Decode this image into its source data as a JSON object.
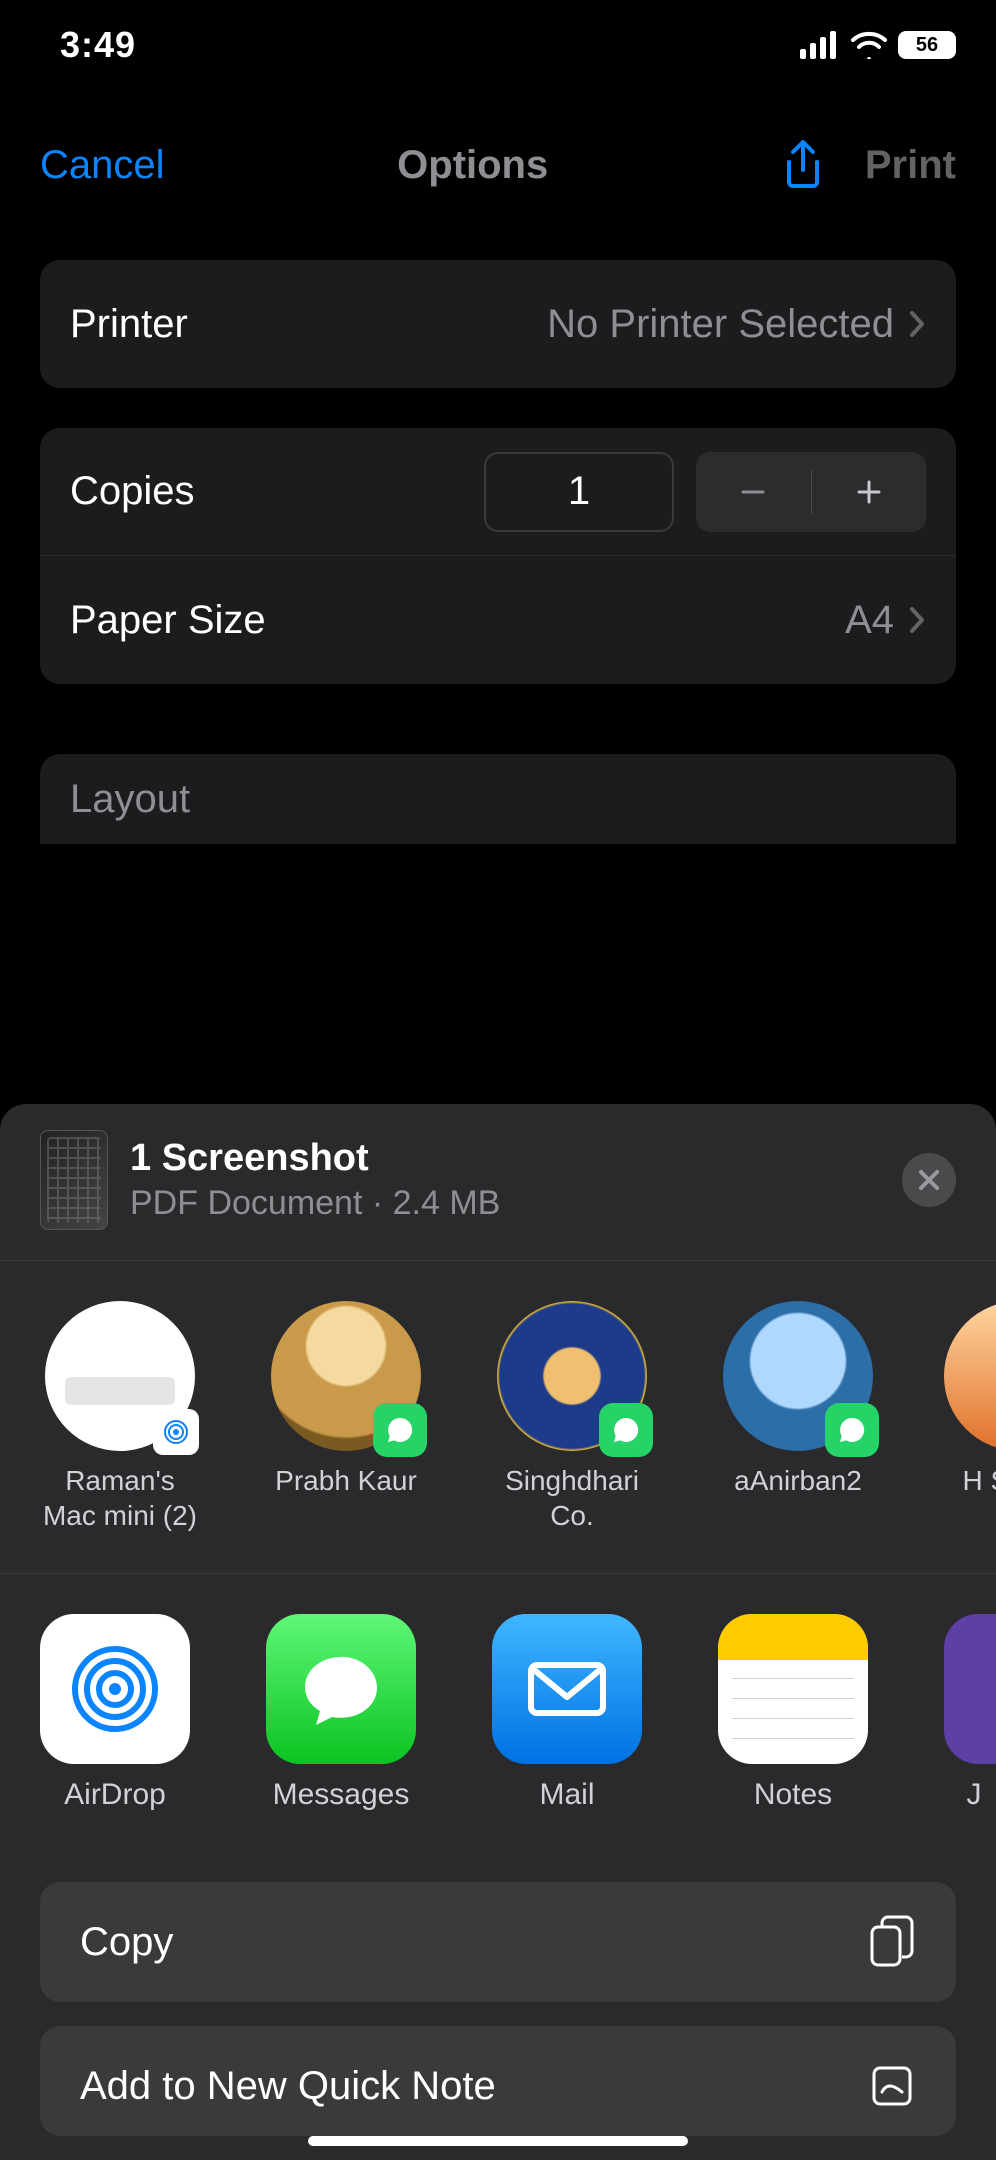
{
  "status": {
    "time": "3:49",
    "battery": "56"
  },
  "nav": {
    "cancel": "Cancel",
    "title": "Options",
    "print": "Print"
  },
  "printer": {
    "label": "Printer",
    "value": "No Printer Selected"
  },
  "copies": {
    "label": "Copies",
    "value": "1"
  },
  "paper": {
    "label": "Paper Size",
    "value": "A4"
  },
  "layout": {
    "label": "Layout"
  },
  "sheet": {
    "doc_title": "1 Screenshot",
    "doc_subtitle": "PDF Document · 2.4 MB",
    "contacts": [
      {
        "name": "Raman's Mac mini (2)",
        "badge": "airdrop"
      },
      {
        "name": "Prabh Kaur",
        "badge": "whatsapp"
      },
      {
        "name": "Singhdhari Co.",
        "badge": "whatsapp"
      },
      {
        "name": "aAnirban2",
        "badge": "whatsapp"
      },
      {
        "name": "H Si",
        "badge": "whatsapp"
      }
    ],
    "apps": [
      {
        "name": "AirDrop"
      },
      {
        "name": "Messages"
      },
      {
        "name": "Mail"
      },
      {
        "name": "Notes"
      },
      {
        "name": "J"
      }
    ],
    "actions": [
      {
        "label": "Copy",
        "icon": "copy-icon"
      },
      {
        "label": "Add to New Quick Note",
        "icon": "quick-note-icon"
      }
    ]
  }
}
